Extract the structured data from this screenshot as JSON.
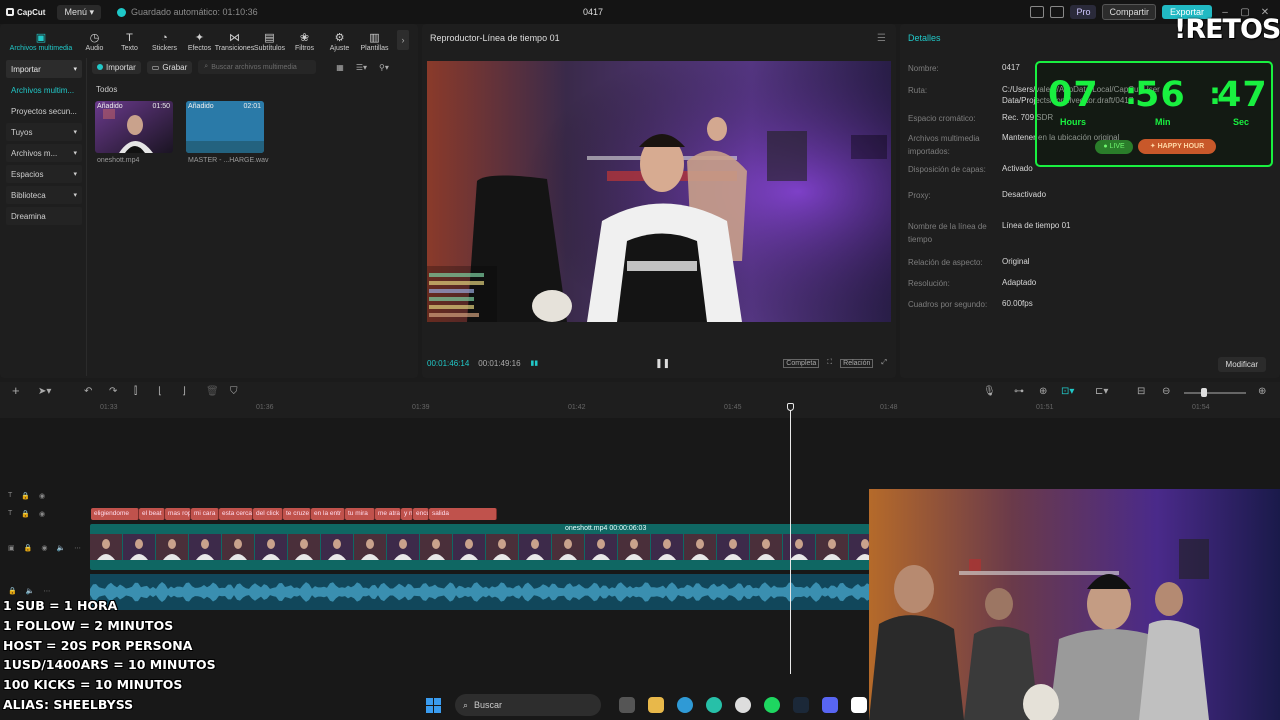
{
  "titlebar": {
    "app_name": "CapCut",
    "menu_label": "Menú",
    "autosave": "Guardado automático: 01:10:36",
    "project": "0417",
    "pro_label": "Pro",
    "share_label": "Compartir",
    "export_label": "Exportar"
  },
  "overlay_brand": "!RETOS",
  "toolbar_tabs": [
    {
      "label": "Archivos multimedia",
      "icon": "media-icon"
    },
    {
      "label": "Audio",
      "icon": "audio-icon"
    },
    {
      "label": "Texto",
      "icon": "text-icon"
    },
    {
      "label": "Stickers",
      "icon": "sticker-icon"
    },
    {
      "label": "Efectos",
      "icon": "effects-icon"
    },
    {
      "label": "Transiciones",
      "icon": "transitions-icon"
    },
    {
      "label": "Subtítulos",
      "icon": "subtitles-icon"
    },
    {
      "label": "Filtros",
      "icon": "filters-icon"
    },
    {
      "label": "Ajuste",
      "icon": "adjust-icon"
    },
    {
      "label": "Plantillas",
      "icon": "templates-icon"
    }
  ],
  "side_nav": [
    {
      "label": "Importar",
      "state": "highlight"
    },
    {
      "label": "Archivos multim...",
      "state": "active"
    },
    {
      "label": "Proyectos secun...",
      "state": "plain"
    },
    {
      "label": "Tuyos",
      "state": "normal"
    },
    {
      "label": "Archivos m...",
      "state": "normal"
    },
    {
      "label": "Espacios",
      "state": "normal"
    },
    {
      "label": "Biblioteca",
      "state": "normal"
    },
    {
      "label": "Dreamina",
      "state": "normal"
    }
  ],
  "media": {
    "import_label": "Importar",
    "record_label": "Grabar",
    "search_placeholder": "Buscar archivos multimedia",
    "all_label": "Todos",
    "items": [
      {
        "badge": "Añadido",
        "duration": "01:50",
        "name": "oneshott.mp4"
      },
      {
        "badge": "Añadido",
        "duration": "02:01",
        "name": "MASTER - ...HARGE.wav"
      }
    ]
  },
  "player": {
    "title": "Reproductor-Línea de tiempo 01",
    "current_time": "00:01:46:14",
    "total_time": "00:01:49:16",
    "full_label": "Completa",
    "ratio_label": "Relación"
  },
  "details": {
    "title": "Detalles",
    "rows": [
      {
        "key": "Nombre:",
        "value": "0417"
      },
      {
        "key": "Ruta:",
        "value": "C:/Users/vale.../AppData/Local/CapCut/User Data/Projects/com.lveditor.draft/0417"
      },
      {
        "key": "Espacio cromático:",
        "value": "Rec. 709 SDR"
      },
      {
        "key": "Archivos multimedia importados:",
        "value": "Mantener en la ubicación original"
      },
      {
        "key": "Disposición de capas:",
        "value": "Activado"
      },
      {
        "key": "Proxy:",
        "value": "Desactivado"
      },
      {
        "key": "Nombre de la línea de tiempo",
        "value": "Línea de tiempo 01"
      },
      {
        "key": "Relación de aspecto:",
        "value": "Original"
      },
      {
        "key": "Resolución:",
        "value": "Adaptado"
      },
      {
        "key": "Cuadros por segundo:",
        "value": "60.00fps"
      }
    ],
    "modify_label": "Modificar"
  },
  "timer": {
    "hours": "07",
    "minutes": "56",
    "seconds": "47",
    "hours_label": "Hours",
    "minutes_label": "Min",
    "seconds_label": "Sec",
    "live_label": "LIVE",
    "happy_label": "HAPPY HOUR",
    "colors": {
      "timer": "#19f040",
      "happy": "#c8582a"
    }
  },
  "timeline": {
    "ruler": [
      "01:33",
      "01:36",
      "01:39",
      "01:42",
      "01:45",
      "01:48",
      "01:51",
      "01:54"
    ],
    "captions": [
      "eligiendome",
      "el beat",
      "mas rop",
      "mi cara",
      "esta cerca",
      "del click",
      "te cruze",
      "en la entr",
      "tu mira",
      "me atra",
      "y n",
      "encu",
      "salida"
    ],
    "video_clip_label": "oneshott.mp4   00:00:06:03"
  },
  "rules": [
    "1 SUB = 1 HORA",
    "1 FOLLOW = 2 MINUTOS",
    "HOST = 20S POR PERSONA",
    "1USD/1400ARS = 10 MINUTOS",
    "100 KICKS = 10 MINUTOS",
    "ALIAS: SHEELBYSS"
  ],
  "taskbar": {
    "search_label": "Buscar"
  },
  "colors": {
    "accent": "#21c8c8",
    "export": "#21b9c3",
    "caption_clip": "#c0524c",
    "video_track": "#0f6763",
    "audio_track": "#11475b"
  }
}
